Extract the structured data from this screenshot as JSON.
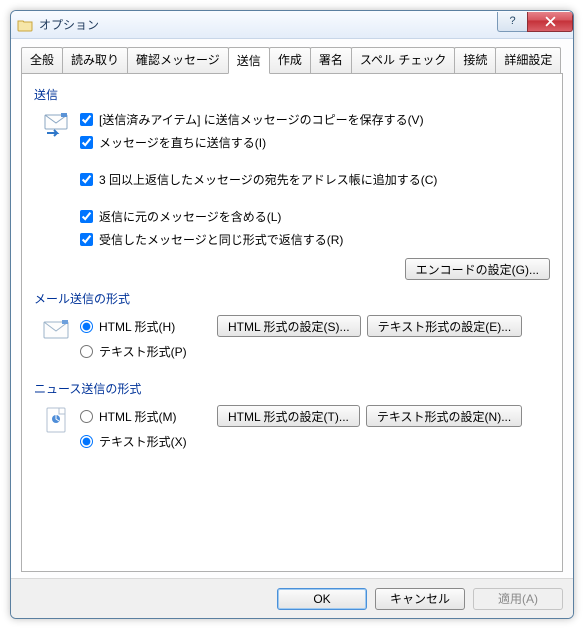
{
  "window": {
    "title": "オプション"
  },
  "tabs": {
    "items": [
      {
        "label": "全般"
      },
      {
        "label": "読み取り"
      },
      {
        "label": "確認メッセージ"
      },
      {
        "label": "送信"
      },
      {
        "label": "作成"
      },
      {
        "label": "署名"
      },
      {
        "label": "スペル チェック"
      },
      {
        "label": "接続"
      },
      {
        "label": "詳細設定"
      }
    ],
    "active_index": 3
  },
  "send": {
    "heading": "送信",
    "opts": {
      "save_copy": {
        "label": "[送信済みアイテム] に送信メッセージのコピーを保存する(V)",
        "checked": true
      },
      "send_now": {
        "label": "メッセージを直ちに送信する(I)",
        "checked": true
      },
      "add_addr": {
        "label": "3 回以上返信したメッセージの宛先をアドレス帳に追加する(C)",
        "checked": true
      },
      "include_orig": {
        "label": "返信に元のメッセージを含める(L)",
        "checked": true
      },
      "same_format": {
        "label": "受信したメッセージと同じ形式で返信する(R)",
        "checked": true
      }
    },
    "encoding_btn": "エンコードの設定(G)..."
  },
  "mail_format": {
    "heading": "メール送信の形式",
    "html_label": "HTML 形式(H)",
    "text_label": "テキスト形式(P)",
    "selected": "html",
    "html_btn": "HTML 形式の設定(S)...",
    "text_btn": "テキスト形式の設定(E)..."
  },
  "news_format": {
    "heading": "ニュース送信の形式",
    "html_label": "HTML 形式(M)",
    "text_label": "テキスト形式(X)",
    "selected": "text",
    "html_btn": "HTML 形式の設定(T)...",
    "text_btn": "テキスト形式の設定(N)..."
  },
  "footer": {
    "ok": "OK",
    "cancel": "キャンセル",
    "apply": "適用(A)",
    "apply_enabled": false
  }
}
